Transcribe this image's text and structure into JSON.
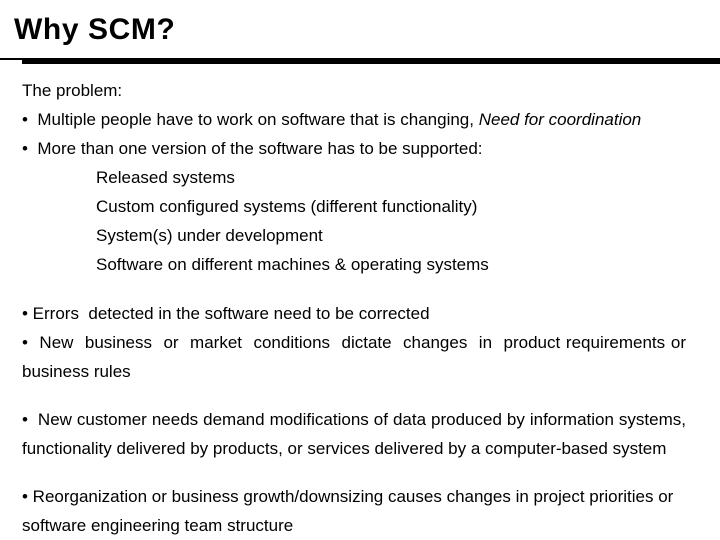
{
  "slide": {
    "title": "Why SCM?",
    "lead": "The problem:",
    "bullet_char": "•",
    "bullets": [
      {
        "text_before_italic": "•  Multiple people have to work on software that is changing, ",
        "italic_text": "Need for coordination"
      }
    ],
    "bullet_versions": "•  More than one version of the software has to be supported:",
    "subitems": [
      "Released systems",
      "Custom configured systems (different functionality)",
      "System(s) under development",
      "Software on different machines & operating systems"
    ],
    "bullet_errors": "• Errors  detected in the software need to be corrected",
    "bullet_business": "•  New  business  or  market  conditions  dictate  changes  in  product requirements or business rules",
    "bullet_customer": "•  New customer needs demand modifications of data produced by information systems, functionality delivered by products, or services delivered by a computer-based system",
    "bullet_reorg": "• Reorganization or business growth/downsizing causes changes in project priorities or software engineering team structure"
  },
  "colors": {
    "background": "#ffffff",
    "text": "#000000",
    "rule": "#000000"
  }
}
